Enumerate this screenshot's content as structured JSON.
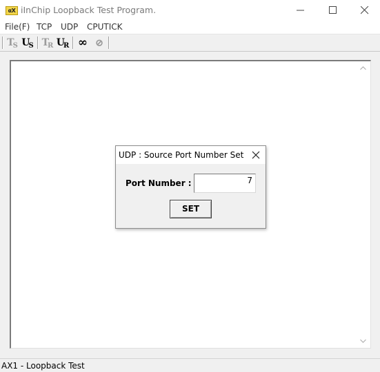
{
  "window": {
    "icon_text": "αX",
    "title": "iInChip Loopback Test Program."
  },
  "menu": {
    "items": [
      "File(F)",
      "TCP",
      "UDP",
      "CPUTICK"
    ]
  },
  "toolbar": {
    "buttons": [
      {
        "main": "T",
        "sub": "S",
        "state": "disabled"
      },
      {
        "main": "U",
        "sub": "S",
        "state": "active"
      },
      {
        "main": "T",
        "sub": "R",
        "state": "disabled"
      },
      {
        "main": "U",
        "sub": "R",
        "state": "active"
      },
      {
        "main": "∞",
        "sub": "",
        "state": "active"
      },
      {
        "main": "⊘",
        "sub": "",
        "state": "disabled"
      }
    ]
  },
  "dialog": {
    "title": "UDP : Source Port Number Set",
    "label": "Port Number :",
    "port_value": "7",
    "button_label": "SET"
  },
  "statusbar": {
    "text": "AX1 - Loopback Test"
  }
}
